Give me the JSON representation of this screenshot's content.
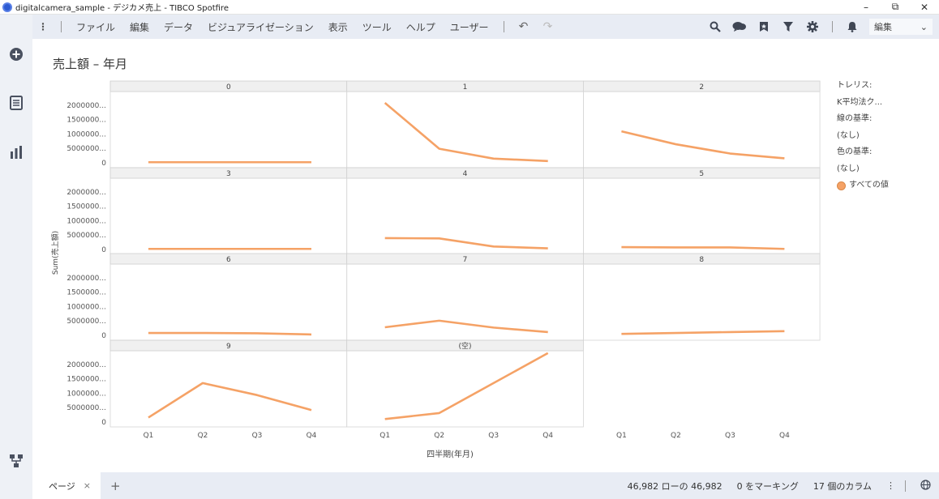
{
  "window": {
    "title": "digitalcamera_sample - デジカメ売上 - TIBCO Spotfire",
    "minimize": "–",
    "restore": "⧉",
    "close": "✕"
  },
  "menu": {
    "kebab": "⋮",
    "items": [
      "ファイル",
      "編集",
      "データ",
      "ビジュアライゼーション",
      "表示",
      "ツール",
      "ヘルプ",
      "ユーザー"
    ],
    "undo": "↶",
    "redo": "↷",
    "mode": "編集",
    "mode_chevron": "⌄"
  },
  "toolbar_icons": [
    "search-icon",
    "chat-icon",
    "bookmark-icon",
    "filter-icon",
    "gear-icon",
    "bell-icon"
  ],
  "left_icons": [
    "add-icon",
    "data-table-icon",
    "chart-icon",
    "hierarchy-icon"
  ],
  "visualization": {
    "title": "売上額 – 年月",
    "legend": {
      "trellis_label": "トレリス:",
      "trellis_value": "K平均法ク...",
      "line_label": "線の基準:",
      "line_value": "(なし)",
      "color_label": "色の基準:",
      "color_value": "(なし)",
      "item": "すべての値"
    }
  },
  "chart_data": {
    "type": "line",
    "trellis": true,
    "ylabel": "Sum(売上額)",
    "xlabel": "四半期(年月)",
    "categories": [
      "Q1",
      "Q2",
      "Q3",
      "Q4"
    ],
    "ytick_labels": [
      "2000000...",
      "1500000...",
      "1000000...",
      "5000000...",
      "0"
    ],
    "ylim": [
      0,
      2000
    ],
    "color": "#f5a266",
    "panels": [
      {
        "name": "0",
        "values": [
          20,
          20,
          20,
          20
        ]
      },
      {
        "name": "1",
        "values": [
          2000,
          470,
          140,
          60
        ]
      },
      {
        "name": "2",
        "values": [
          1050,
          620,
          310,
          150
        ]
      },
      {
        "name": "3",
        "values": [
          20,
          20,
          20,
          20
        ]
      },
      {
        "name": "4",
        "values": [
          380,
          370,
          100,
          40
        ]
      },
      {
        "name": "5",
        "values": [
          80,
          70,
          70,
          20
        ]
      },
      {
        "name": "6",
        "values": [
          80,
          80,
          70,
          30
        ]
      },
      {
        "name": "7",
        "values": [
          270,
          490,
          260,
          110
        ]
      },
      {
        "name": "8",
        "values": [
          50,
          80,
          110,
          140
        ]
      },
      {
        "name": "9",
        "values": [
          150,
          1300,
          900,
          400
        ]
      },
      {
        "name": "(空)",
        "values": [
          100,
          300,
          1300,
          2300
        ]
      }
    ]
  },
  "bottom": {
    "tab_label": "ページ",
    "tab_close": "×",
    "add_tab": "+",
    "rows": "46,982 ローの 46,982",
    "marked": "0 をマーキング",
    "columns": "17 個のカラム",
    "more": "⋮"
  }
}
